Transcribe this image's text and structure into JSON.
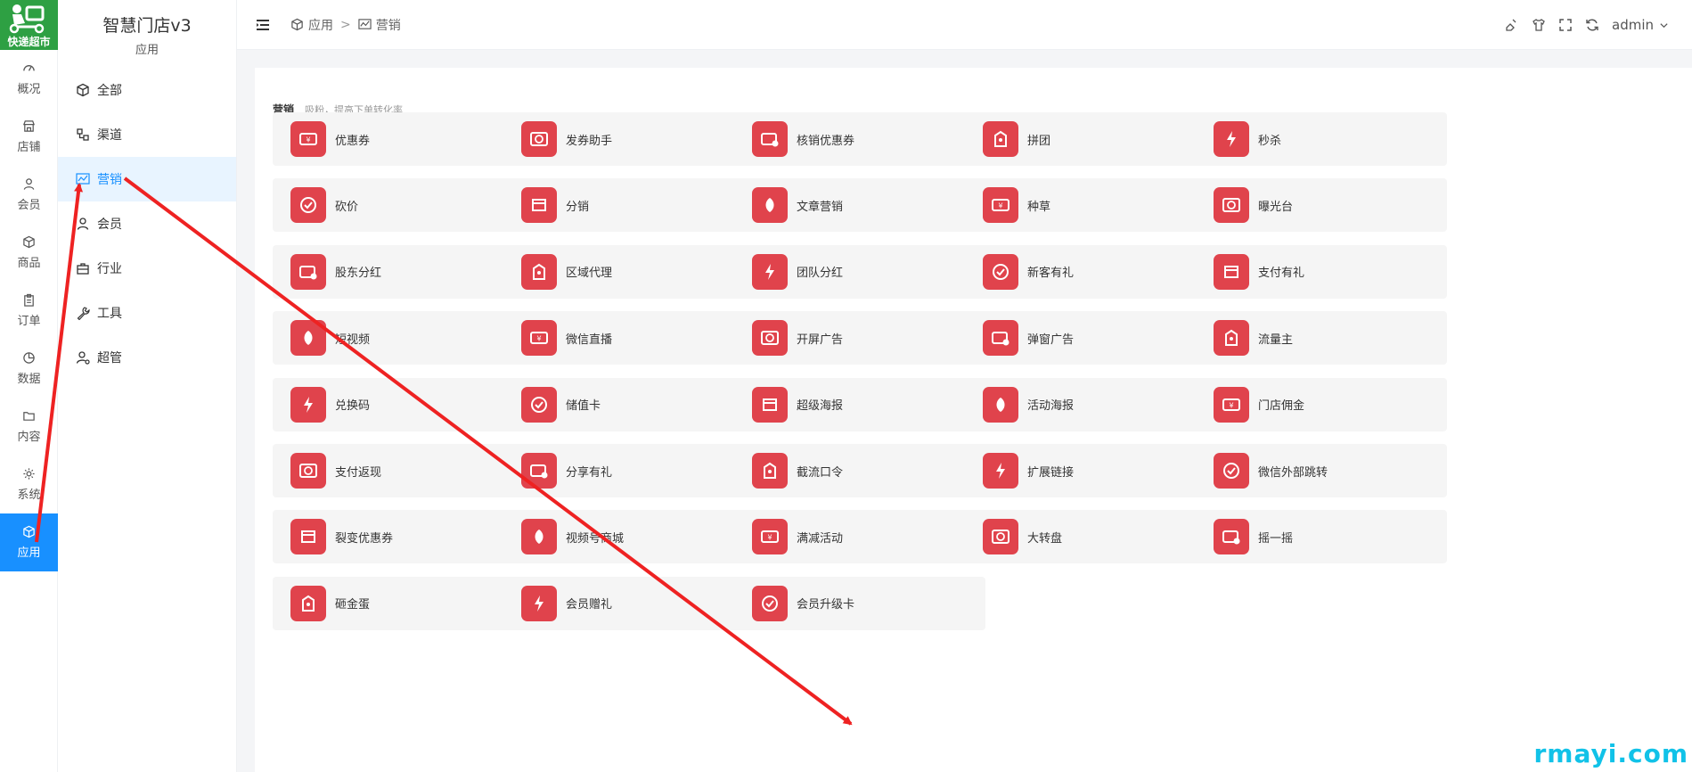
{
  "brand": {
    "logo_text": "快递超市",
    "logo_color": "#2ea043"
  },
  "rail": {
    "items": [
      {
        "label": "概况",
        "icon": "dashboard-icon"
      },
      {
        "label": "店铺",
        "icon": "store-icon"
      },
      {
        "label": "会员",
        "icon": "user-icon"
      },
      {
        "label": "商品",
        "icon": "cube-icon"
      },
      {
        "label": "订单",
        "icon": "clipboard-icon"
      },
      {
        "label": "数据",
        "icon": "pie-icon"
      },
      {
        "label": "内容",
        "icon": "folder-icon"
      },
      {
        "label": "系统",
        "icon": "gear-icon"
      },
      {
        "label": "应用",
        "icon": "cube-icon",
        "active": true
      }
    ]
  },
  "submenu": {
    "title": "智慧门店v3",
    "caption": "应用",
    "items": [
      {
        "label": "全部",
        "icon": "cube-icon"
      },
      {
        "label": "渠道",
        "icon": "channel-icon"
      },
      {
        "label": "营销",
        "icon": "chart-line-icon",
        "active": true
      },
      {
        "label": "会员",
        "icon": "user-icon"
      },
      {
        "label": "行业",
        "icon": "briefcase-icon"
      },
      {
        "label": "工具",
        "icon": "wrench-icon"
      },
      {
        "label": "超管",
        "icon": "user-gear-icon"
      }
    ]
  },
  "header": {
    "breadcrumb": [
      "应用",
      "营销"
    ],
    "separator": ">",
    "user": "admin"
  },
  "section": {
    "title": "营销",
    "description": "吸粉，提高下单转化率"
  },
  "tiles": [
    [
      "优惠券",
      "发券助手",
      "核销优惠券",
      "拼团",
      "秒杀"
    ],
    [
      "砍价",
      "分销",
      "文章营销",
      "种草",
      "曝光台"
    ],
    [
      "股东分红",
      "区域代理",
      "团队分红",
      "新客有礼",
      "支付有礼"
    ],
    [
      "短视频",
      "微信直播",
      "开屏广告",
      "弹窗广告",
      "流量主"
    ],
    [
      "兑换码",
      "储值卡",
      "超级海报",
      "活动海报",
      "门店佣金"
    ],
    [
      "支付返现",
      "分享有礼",
      "截流口令",
      "扩展链接",
      "微信外部跳转"
    ],
    [
      "裂变优惠券",
      "视频号商城",
      "满减活动",
      "大转盘",
      "摇一摇"
    ],
    [
      "砸金蛋",
      "会员赠礼",
      "会员升级卡"
    ]
  ],
  "tile_icon_color": "#e0434c",
  "accent_color": "#1890ff",
  "annotation_color": "#ee2222",
  "watermark": "rmayi.com"
}
